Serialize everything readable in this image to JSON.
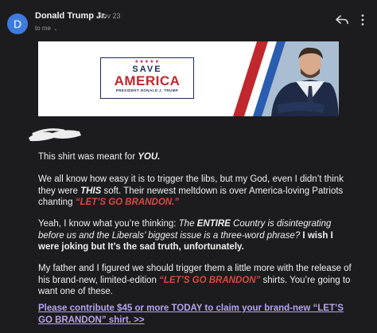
{
  "header": {
    "avatar_letter": "D",
    "sender": "Donald Trump Jr.",
    "date": "Nov 23",
    "to": "to me",
    "reply_icon": "reply-icon",
    "more_icon": "more-vertical-icon"
  },
  "banner": {
    "stars": "★★★★★",
    "save": "SAVE",
    "america": "AMERICA",
    "subtitle": "PRESIDENT DONALD J. TRUMP"
  },
  "body": {
    "p1_a": "This shirt was meant for ",
    "p1_b": "YOU.",
    "p2_a": "We all know how easy it is to trigger the libs, but my God, even I didn’t think they were ",
    "p2_b": "THIS",
    "p2_c": " soft. Their newest meltdown is over America-loving Patriots chanting ",
    "p2_d": "“LET’S GO BRANDON.”",
    "p3_a": "Yeah, I know what you’re thinking: ",
    "p3_b": "The ",
    "p3_c": "ENTIRE",
    "p3_d": " Country is disintegrating before us and the Liberals’ biggest issue is a three-word phrase?",
    "p3_e": " I wish I were joking but It’s the sad truth, unfortunately.",
    "p4_a": "My father and I figured we should trigger them a little more with the release of his brand-new, limited-edition ",
    "p4_b": "“LET’S GO BRANDON”",
    "p4_c": " shirts. You’re going to want one of these.",
    "link": "Please contribute $45 or more TODAY to claim your brand-new “LET’S GO BRANDON” shirt. >>"
  },
  "colors": {
    "background": "#1c1c1e",
    "accent_red": "#e0463f",
    "link": "#b8a4f0",
    "avatar": "#3d7be0",
    "navy": "#1f2a5a"
  }
}
